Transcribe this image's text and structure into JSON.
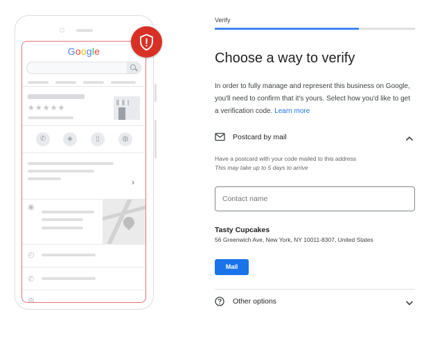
{
  "illustration": {
    "logo_text": "Google",
    "logo_colors": [
      "#4285f4",
      "#ea4335",
      "#fbbc05",
      "#4285f4",
      "#34a853",
      "#ea4335"
    ],
    "star_glyphs": "★★★★★",
    "chevron_glyph": "›",
    "badge_color": "#d93025",
    "badge_icon": "shield-alert-icon",
    "action_icons": [
      "phone-icon",
      "directions-icon",
      "bookmark-icon",
      "globe-icon"
    ],
    "row_icons": [
      "location-pin-icon",
      "clock-icon",
      "phone-icon",
      "globe-icon"
    ]
  },
  "header": {
    "step_label": "Verify",
    "progress_fraction": 0.72
  },
  "main": {
    "title": "Choose a way to verify",
    "intro_text": "In order to fully manage and represent this business on Google, you'll need to confirm that it's yours. Select how you'd like to get a verification code.",
    "learn_more_label": "Learn more"
  },
  "postcard_option": {
    "label": "Postcard by mail",
    "icon": "mail-envelope-icon",
    "expanded": true,
    "description": "Have a postcard with your code mailed to this address",
    "note": "This may take up to 5 days to arrive",
    "contact_placeholder": "Contact name",
    "business_name": "Tasty Cupcakes",
    "business_address": "56 Greenwich Ave, New York, NY 10011-8307, United States",
    "mail_button_label": "Mail"
  },
  "other_option": {
    "label": "Other options",
    "icon": "help-circle-icon",
    "expanded": false
  },
  "colors": {
    "accent": "#1a73e8",
    "progress": "#4285f4",
    "alert": "#d93025"
  }
}
